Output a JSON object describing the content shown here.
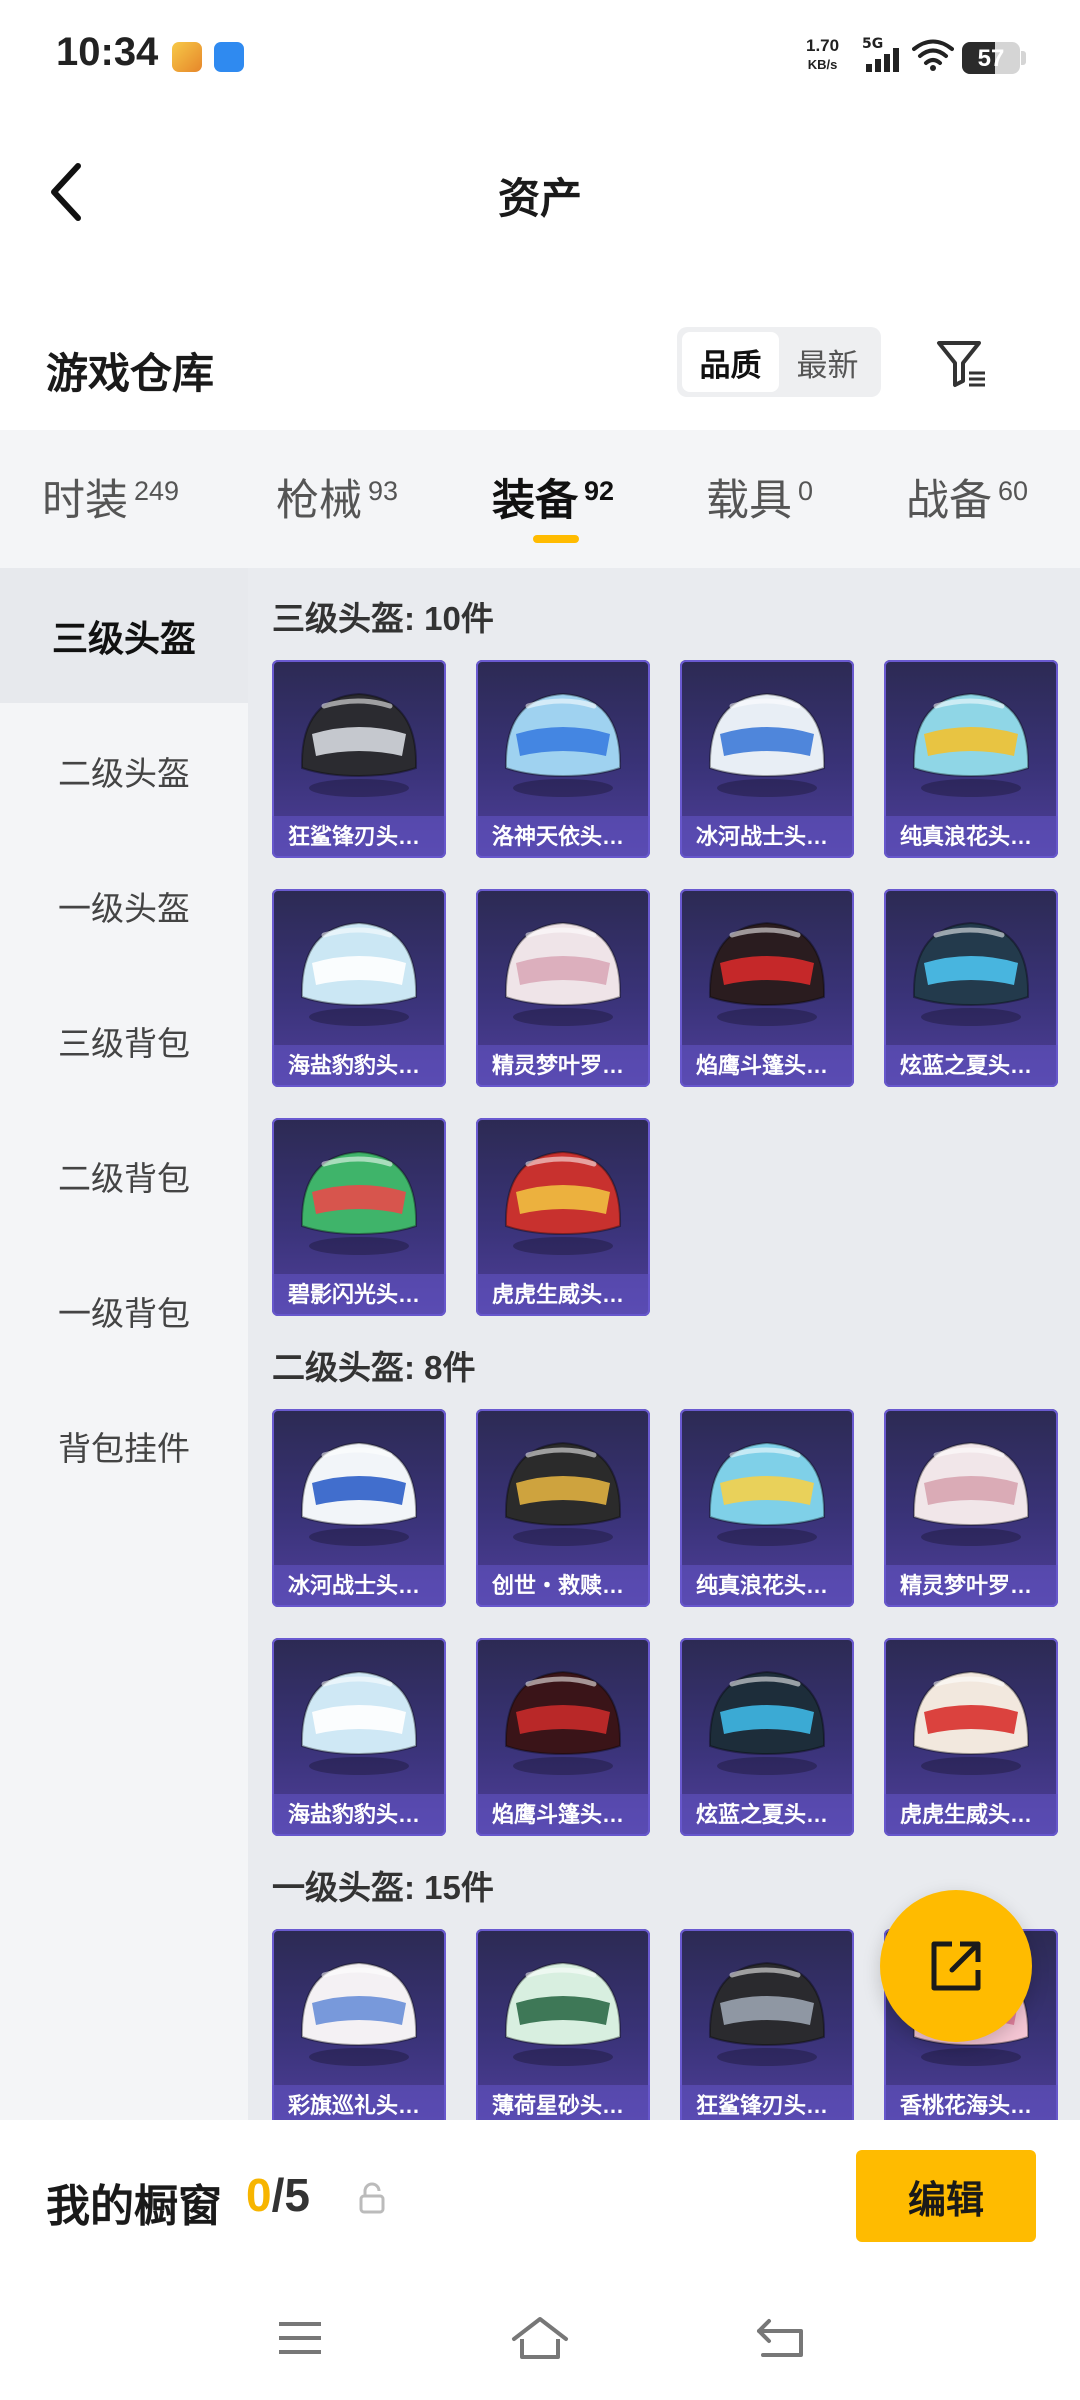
{
  "status": {
    "time": "10:34",
    "net_speed_value": "1.70",
    "net_speed_unit": "KB/s",
    "network": "5G",
    "battery": "57",
    "battery_level": 0.57
  },
  "header": {
    "title": "资产"
  },
  "warehouse": {
    "title": "游戏仓库",
    "sort_options": [
      "品质",
      "最新"
    ],
    "active_sort": "品质"
  },
  "tabs": [
    {
      "label": "时装",
      "count": "249"
    },
    {
      "label": "枪械",
      "count": "93"
    },
    {
      "label": "装备",
      "count": "92",
      "active": true
    },
    {
      "label": "载具",
      "count": "0"
    },
    {
      "label": "战备",
      "count": "60"
    }
  ],
  "sidebar": {
    "items": [
      "三级头盔",
      "二级头盔",
      "一级头盔",
      "三级背包",
      "二级背包",
      "一级背包",
      "背包挂件"
    ],
    "active": "三级头盔"
  },
  "groups": [
    {
      "title": "三级头盔: 10件",
      "items": [
        {
          "name": "狂鲨锋刃头…",
          "icon": "helmet-icon",
          "color": "#2b2b30",
          "accent": "#d6d9e0"
        },
        {
          "name": "洛神天依头…",
          "icon": "helmet-icon",
          "color": "#9fd2f0",
          "accent": "#3a7de0"
        },
        {
          "name": "冰河战士头…",
          "icon": "helmet-icon",
          "color": "#e8eef5",
          "accent": "#3e7ad8"
        },
        {
          "name": "纯真浪花头…",
          "icon": "helmet-icon",
          "color": "#8fd6e6",
          "accent": "#f2c230"
        },
        {
          "name": "海盐豹豹头…",
          "icon": "helmet-icon",
          "color": "#cbe7f4",
          "accent": "#ffffff"
        },
        {
          "name": "精灵梦叶罗…",
          "icon": "helmet-icon",
          "color": "#efe4e8",
          "accent": "#d9a9b8"
        },
        {
          "name": "焰鹰斗篷头…",
          "icon": "helmet-icon",
          "color": "#2a1c1f",
          "accent": "#d62a2a"
        },
        {
          "name": "炫蓝之夏头…",
          "icon": "helmet-icon",
          "color": "#233a4c",
          "accent": "#4dc3f0"
        },
        {
          "name": "碧影闪光头…",
          "icon": "helmet-icon",
          "color": "#3fb46a",
          "accent": "#e84a4a"
        },
        {
          "name": "虎虎生威头…",
          "icon": "helmet-icon",
          "color": "#c8312e",
          "accent": "#f0c040"
        }
      ]
    },
    {
      "title": "二级头盔: 8件",
      "items": [
        {
          "name": "冰河战士头…",
          "icon": "helmet-icon",
          "color": "#f2f5f9",
          "accent": "#2d5fc8"
        },
        {
          "name": "创世・救赎…",
          "icon": "helmet-icon",
          "color": "#2b2b2b",
          "accent": "#e0b040"
        },
        {
          "name": "纯真浪花头…",
          "icon": "helmet-icon",
          "color": "#7fd0e8",
          "accent": "#f5d04a"
        },
        {
          "name": "精灵梦叶罗…",
          "icon": "helmet-icon",
          "color": "#f1e6e9",
          "accent": "#d7a4b0"
        },
        {
          "name": "海盐豹豹头…",
          "icon": "helmet-icon",
          "color": "#cfe8f5",
          "accent": "#ffffff"
        },
        {
          "name": "焰鹰斗篷头…",
          "icon": "helmet-icon",
          "color": "#3a1418",
          "accent": "#c82a2a"
        },
        {
          "name": "炫蓝之夏头…",
          "icon": "helmet-icon",
          "color": "#1d2d3a",
          "accent": "#3fb8e6"
        },
        {
          "name": "虎虎生威头…",
          "icon": "helmet-icon",
          "color": "#f2e8de",
          "accent": "#d8302c"
        }
      ]
    },
    {
      "title": "一级头盔: 15件",
      "items": [
        {
          "name": "彩旗巡礼头…",
          "icon": "helmet-icon",
          "color": "#f4f1f4",
          "accent": "#6a8fd8"
        },
        {
          "name": "薄荷星砂头…",
          "icon": "helmet-icon",
          "color": "#d8efe0",
          "accent": "#2d6a48"
        },
        {
          "name": "狂鲨锋刃头…",
          "icon": "helmet-icon",
          "color": "#2a2a2e",
          "accent": "#9aa3b0"
        },
        {
          "name": "香桃花海头…",
          "icon": "helmet-icon",
          "color": "#f5c6d4",
          "accent": "#e07a98"
        }
      ]
    }
  ],
  "showcase": {
    "label": "我的橱窗",
    "current": "0",
    "max": "/5",
    "edit_label": "编辑"
  }
}
